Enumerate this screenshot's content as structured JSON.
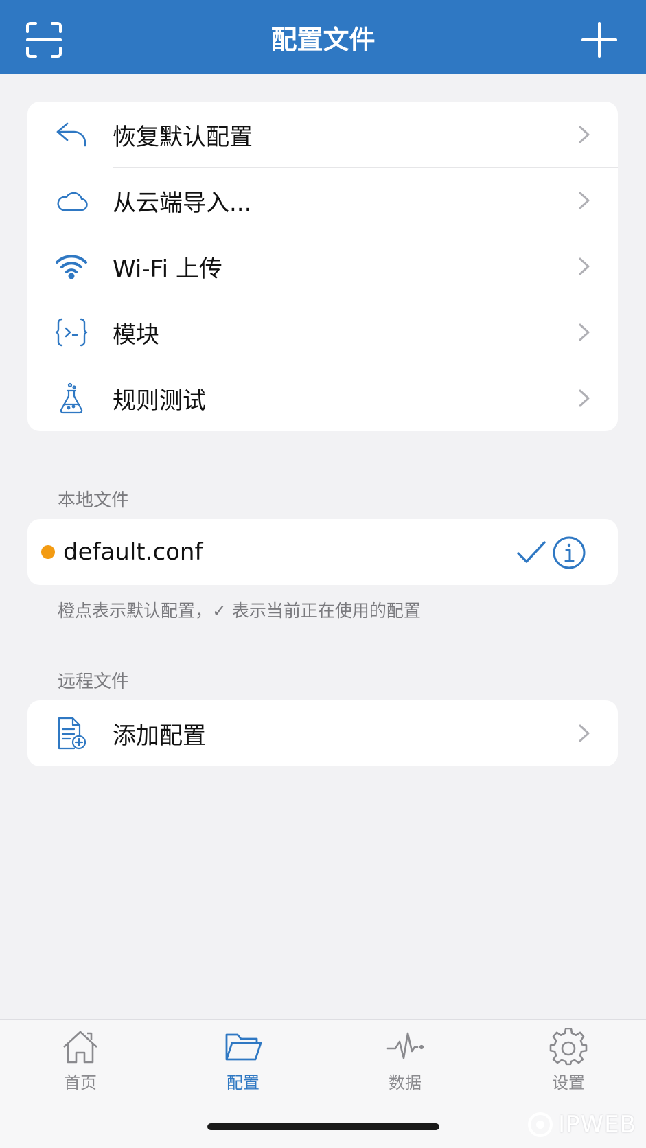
{
  "header": {
    "title": "配置文件",
    "accent": "#2f78c3"
  },
  "menu": {
    "items": [
      {
        "label": "恢复默认配置",
        "icon": "reply-arrow-icon"
      },
      {
        "label": "从云端导入...",
        "icon": "cloud-icon"
      },
      {
        "label": "Wi-Fi 上传",
        "icon": "wifi-icon"
      },
      {
        "label": "模块",
        "icon": "module-braces-icon"
      },
      {
        "label": "规则测试",
        "icon": "flask-icon"
      }
    ]
  },
  "local": {
    "section_title": "本地文件",
    "file_name": "default.conf",
    "default_dot_color": "#f39b12",
    "note": "橙点表示默认配置，✓ 表示当前正在使用的配置"
  },
  "remote": {
    "section_title": "远程文件",
    "add_label": "添加配置"
  },
  "tabs": [
    {
      "label": "首页",
      "icon": "home-icon",
      "active": false
    },
    {
      "label": "配置",
      "icon": "folder-icon",
      "active": true
    },
    {
      "label": "数据",
      "icon": "activity-icon",
      "active": false
    },
    {
      "label": "设置",
      "icon": "gear-icon",
      "active": false
    }
  ],
  "watermark": {
    "text": "IPWEB"
  }
}
